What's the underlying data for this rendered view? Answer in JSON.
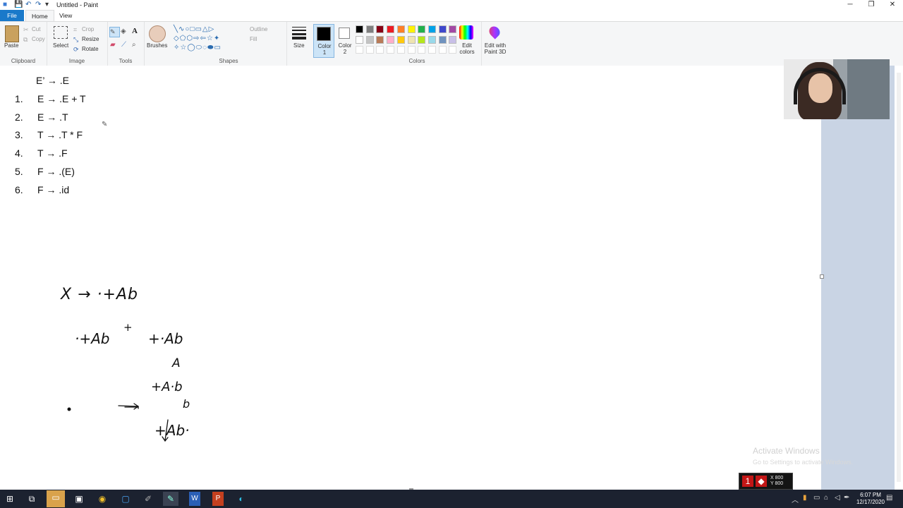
{
  "window": {
    "title": "Untitled - Paint",
    "controls": [
      "minimize",
      "restore",
      "close"
    ]
  },
  "tabs": [
    "File",
    "Home",
    "View"
  ],
  "ribbon": {
    "clipboard": {
      "label": "Clipboard",
      "paste": "Paste",
      "cut": "Cut",
      "copy": "Copy"
    },
    "image": {
      "label": "Image",
      "select": "Select",
      "crop": "Crop",
      "resize": "Resize",
      "rotate": "Rotate"
    },
    "tools": {
      "label": "Tools"
    },
    "brushes": {
      "label": "Brushes"
    },
    "shapes": {
      "label": "Shapes",
      "outline": "Outline",
      "fill": "Fill"
    },
    "size": {
      "label": "Size"
    },
    "color1": {
      "label": "Color 1",
      "value": "#000000"
    },
    "color2": {
      "label": "Color 2",
      "value": "#ffffff"
    },
    "colors": {
      "label": "Colors",
      "edit": "Edit colors",
      "palette_row1": [
        "#000000",
        "#7f7f7f",
        "#880015",
        "#ed1c24",
        "#ff7f27",
        "#fff200",
        "#22b14c",
        "#00a2e8",
        "#3f48cc",
        "#a349a4"
      ],
      "palette_row2": [
        "#ffffff",
        "#c3c3c3",
        "#b97a57",
        "#ffaec9",
        "#ffc90e",
        "#efe4b0",
        "#b5e61d",
        "#99d9ea",
        "#7092be",
        "#c8bfe7"
      ]
    },
    "paint3d": {
      "label": "Edit with Paint 3D"
    }
  },
  "canvas": {
    "grammar_start": "E’ → .E",
    "grammar": [
      {
        "num": "1.",
        "rule": "E → .E + T"
      },
      {
        "num": "2.",
        "rule": "E → .T"
      },
      {
        "num": "3.",
        "rule": "T → .T * F"
      },
      {
        "num": "4.",
        "rule": "T → .F"
      },
      {
        "num": "5.",
        "rule": "F → .(E)"
      },
      {
        "num": "6.",
        "rule": "F → .id"
      }
    ],
    "handwriting": {
      "production": "X → ·+Ab",
      "step1_from": "·+Ab",
      "step1_symbol": "+",
      "step1_to": "+·Ab",
      "step2_symbol": "A",
      "step2_to": "+A·b",
      "step3_symbol": "b",
      "step3_to": "+Ab·"
    }
  },
  "watermark": {
    "line1": "Activate Windows",
    "line2": "Go to Settings to activate Windows."
  },
  "recorder": {
    "x": "X 800",
    "y": "Y 800"
  },
  "taskbar": {
    "time": "6:07 PM",
    "date": "12/17/2020"
  }
}
